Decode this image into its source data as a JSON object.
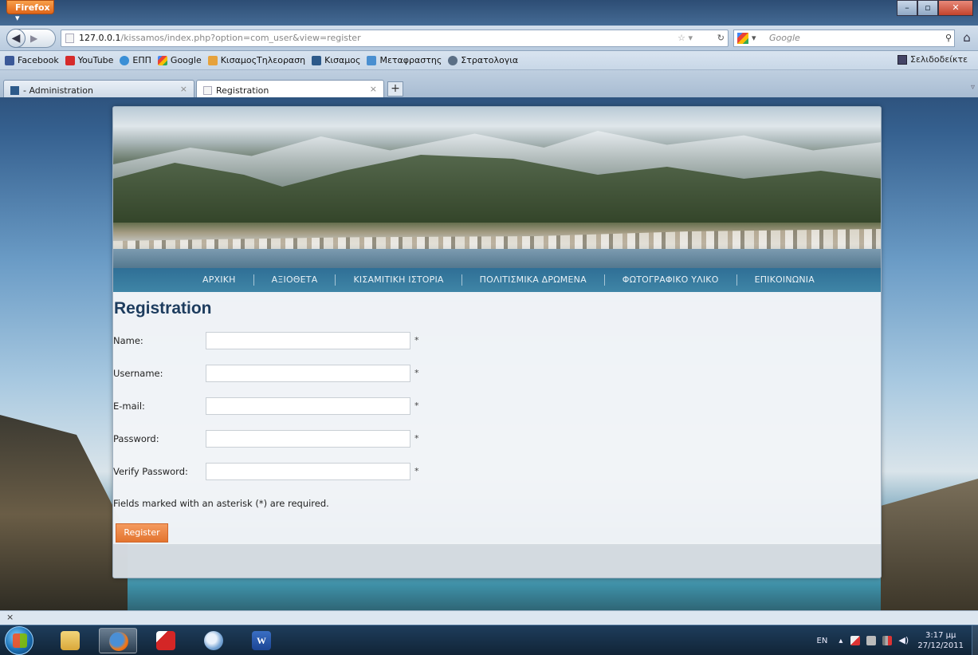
{
  "browser": {
    "menu_button": "Firefox",
    "url_host": "127.0.0.1",
    "url_path": "/kissamos/index.php?option=com_user&view=register",
    "search_placeholder": "Google"
  },
  "bookmarks": {
    "items": [
      {
        "label": "Facebook",
        "color": "#3b5998"
      },
      {
        "label": "YouTube",
        "color": "#d62b2b"
      },
      {
        "label": "ΕΠΠ",
        "color": "#3a8fd6"
      },
      {
        "label": "Google",
        "color": "#fbbc05"
      },
      {
        "label": "ΚισαμοςΤηλεοραση",
        "color": "#e6a23c"
      },
      {
        "label": "Κισαμος",
        "color": "#2d5a8a"
      },
      {
        "label": "Μεταφραστης",
        "color": "#4a8fd0"
      },
      {
        "label": "Στρατολογια",
        "color": "#5b6f85"
      }
    ],
    "right_label": "Σελιδοδείκτε"
  },
  "tabs": [
    {
      "label": "- Administration",
      "close": "×"
    },
    {
      "label": "Registration",
      "close": "×"
    }
  ],
  "new_tab_label": "+",
  "site": {
    "menu": [
      "ΑΡΧΙΚΗ",
      "ΑΞΙΟΘΕΤΑ",
      "ΚΙΣΑΜΙΤΙΚΗ ΙΣΤΟΡΙΑ",
      "ΠΟΛΙΤΙΣΜΙΚΑ ΔΡΩΜΕΝΑ",
      "ΦΩΤΟΓΡΑΦΙΚΟ ΥΛΙΚΟ",
      "ΕΠΙΚΟΙΝΩΝΙΑ"
    ],
    "heading": "Registration",
    "fields": [
      {
        "label": "Name:",
        "value": "",
        "required": "*"
      },
      {
        "label": "Username:",
        "value": "",
        "required": "*"
      },
      {
        "label": "E-mail:",
        "value": "",
        "required": "*"
      },
      {
        "label": "Password:",
        "value": "",
        "required": "*"
      },
      {
        "label": "Verify Password:",
        "value": "",
        "required": "*"
      }
    ],
    "note": "Fields marked with an asterisk (*) are required.",
    "register_button": "Register"
  },
  "statusbar": {
    "close": "×"
  },
  "taskbar": {
    "language": "EN",
    "time": "3:17 μμ",
    "date": "27/12/2011"
  }
}
